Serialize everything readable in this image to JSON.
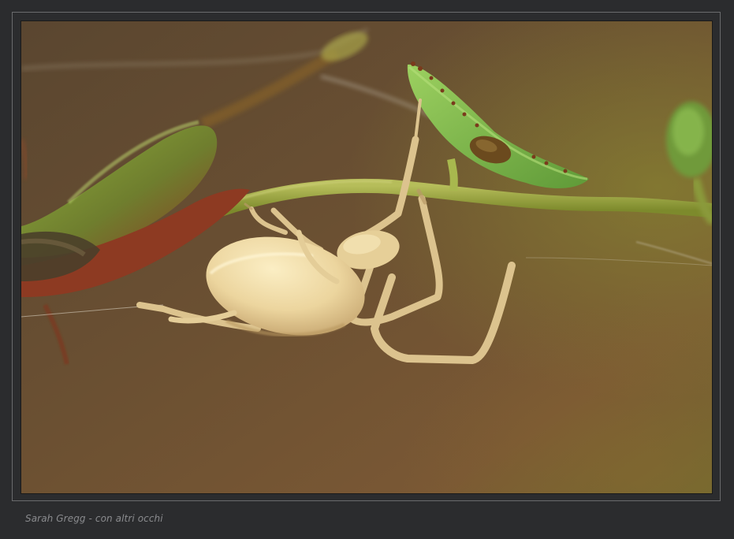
{
  "photo": {
    "subject": "crab-spider-on-plant-stem",
    "colors": {
      "background_dark": "#4a3a24",
      "background_warm": "#7a5a34",
      "background_green": "#6a6a2c",
      "stem_green": "#9aa53c",
      "bud_red": "#9a3a24",
      "leaf_green": "#7fb24a",
      "spider_body": "#eedcaa",
      "spider_shadow": "#c9ad78"
    }
  },
  "caption": {
    "credit": "Sarah Gregg - con altri occhi"
  },
  "frame": {
    "border_color": "#6a6b6d",
    "page_background": "#2b2c2e"
  }
}
